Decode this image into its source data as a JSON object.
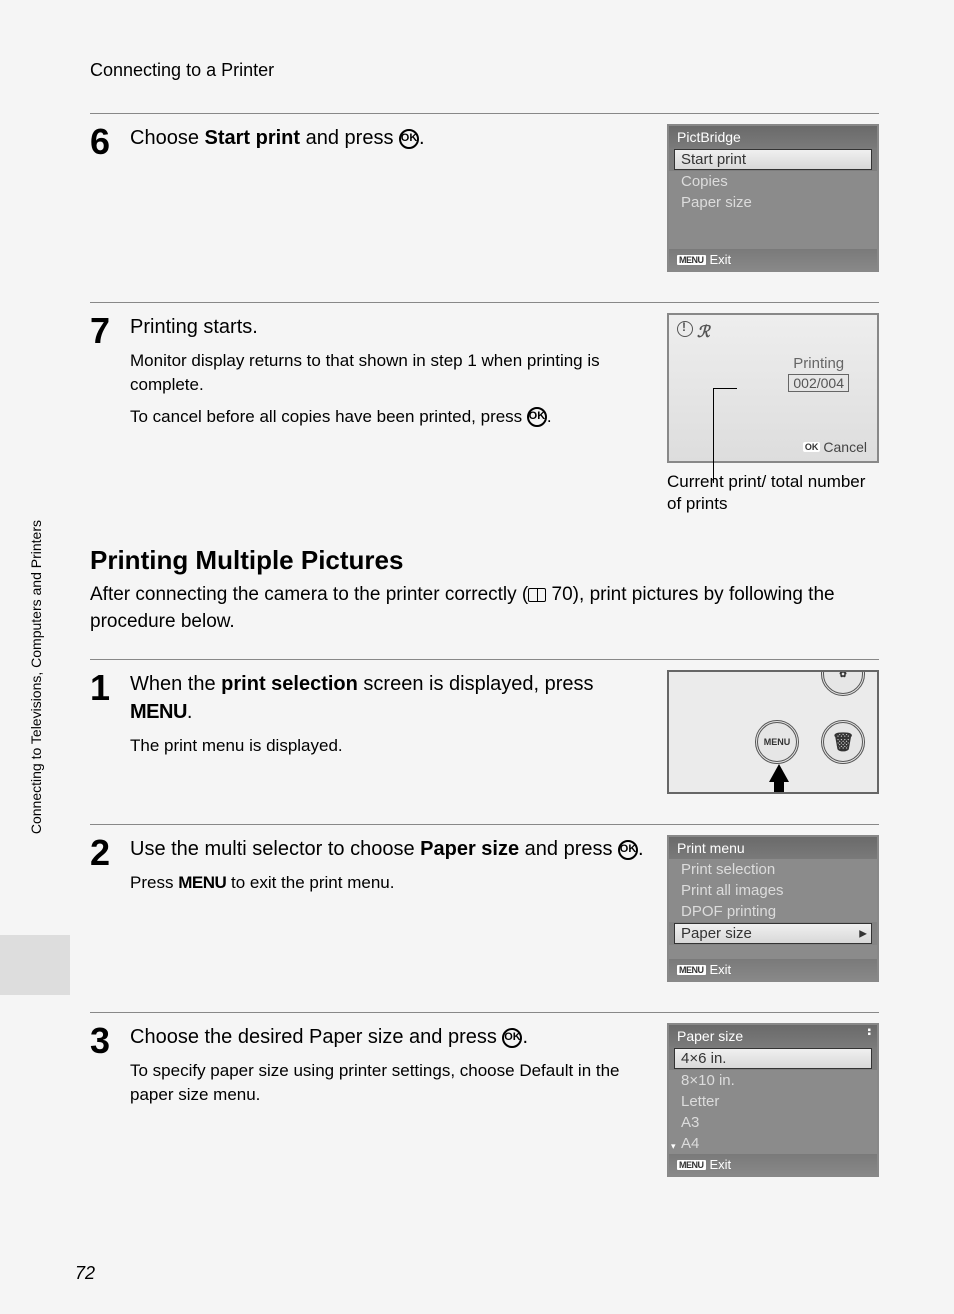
{
  "header": "Connecting to a Printer",
  "sideTab": "Connecting to Televisions, Computers and Printers",
  "pageNumber": "72",
  "step6": {
    "num": "6",
    "text_pre": "Choose ",
    "text_bold": "Start print",
    "text_post": " and press ",
    "lcd": {
      "title": "PictBridge",
      "items": [
        "Start print",
        "Copies",
        "Paper size"
      ],
      "exit": "Exit"
    }
  },
  "step7": {
    "num": "7",
    "title": "Printing starts.",
    "body1": "Monitor display returns to that shown in step 1 when printing is complete.",
    "body2_pre": "To cancel before all copies have been printed, press ",
    "progress": {
      "label": "Printing",
      "count": "002/004",
      "cancel": "Cancel"
    },
    "caption": "Current print/ total number of prints"
  },
  "section": {
    "title": "Printing Multiple Pictures",
    "intro_pre": "After connecting the camera to the printer correctly (",
    "intro_ref": " 70), print pictures by following the procedure below."
  },
  "mstep1": {
    "num": "1",
    "t1": "When the ",
    "t1b": "print selection",
    "t2": " screen is displayed, press ",
    "menu": "MENU",
    "sub_pre": "The ",
    "sub_bold": "print menu",
    "sub_post": " is displayed.",
    "btnMenu": "MENU"
  },
  "mstep2": {
    "num": "2",
    "t1": "Use the multi selector to choose ",
    "t1b": "Paper size",
    "t2": " and press ",
    "sub_pre": "Press ",
    "sub_menu": "MENU",
    "sub_post": " to exit the print menu.",
    "lcd": {
      "title": "Print menu",
      "items": [
        "Print selection",
        "Print all images",
        "DPOF printing"
      ],
      "selected": "Paper size",
      "exit": "Exit"
    }
  },
  "mstep3": {
    "num": "3",
    "t1": "Choose the desired Paper size and press ",
    "sub_pre": "To specify paper size using printer settings, choose ",
    "sub_bold": "Default",
    "sub_post": " in the paper size menu.",
    "lcd": {
      "title": "Paper size",
      "selected": "4×6 in.",
      "items": [
        "8×10 in.",
        "Letter",
        "A3",
        "A4"
      ],
      "exit": "Exit"
    }
  }
}
